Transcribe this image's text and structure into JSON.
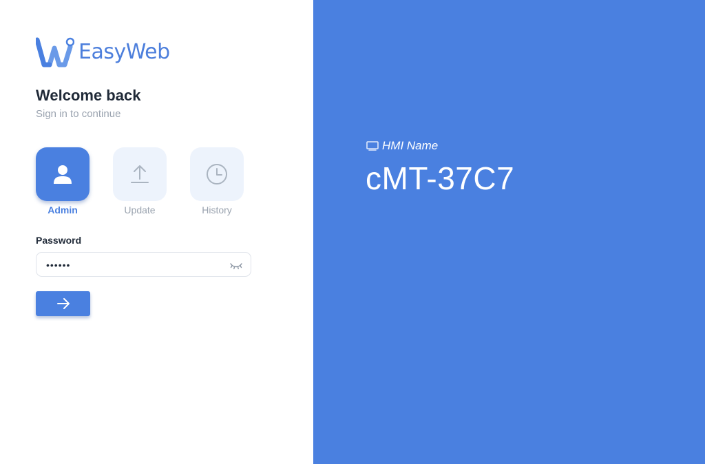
{
  "brand": {
    "name": "EasyWeb",
    "color": "#4a80e0"
  },
  "login": {
    "title": "Welcome back",
    "subtitle": "Sign in to continue",
    "tabs": [
      {
        "label": "Admin",
        "icon": "user-icon",
        "active": true
      },
      {
        "label": "Update",
        "icon": "upload-icon",
        "active": false
      },
      {
        "label": "History",
        "icon": "clock-icon",
        "active": false
      }
    ],
    "password": {
      "label": "Password",
      "value": "••••••",
      "toggle_icon": "eye-closed-icon"
    },
    "submit_icon": "arrow-right-icon"
  },
  "hmi": {
    "icon": "monitor-icon",
    "label": "HMI Name",
    "name": "cMT-37C7",
    "panel_color": "#4a80e0"
  }
}
